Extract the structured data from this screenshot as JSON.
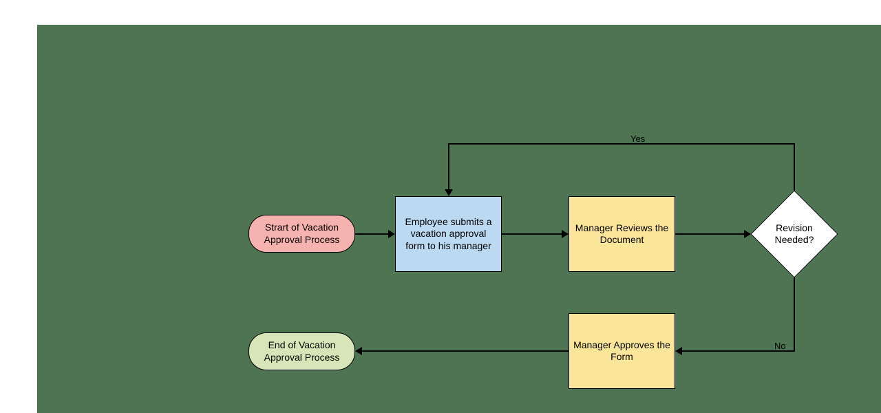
{
  "nodes": {
    "start": {
      "label": "Strart of Vacation Approval Process"
    },
    "submit": {
      "label": "Employee submits a vacation approval form to his manager"
    },
    "review": {
      "label": "Manager Reviews the Document"
    },
    "decision": {
      "label": "Revision Needed?"
    },
    "approve": {
      "label": "Manager Approves the Form"
    },
    "end": {
      "label": "End of Vacation Approval Process"
    }
  },
  "edges": {
    "yes": {
      "label": "Yes"
    },
    "no": {
      "label": "No"
    }
  },
  "colors": {
    "canvas": "#4f7451",
    "start": "#f6b2af",
    "process1": "#bbdaf2",
    "process2": "#fae599",
    "decision": "#ffffff",
    "end": "#d6e6b8"
  }
}
